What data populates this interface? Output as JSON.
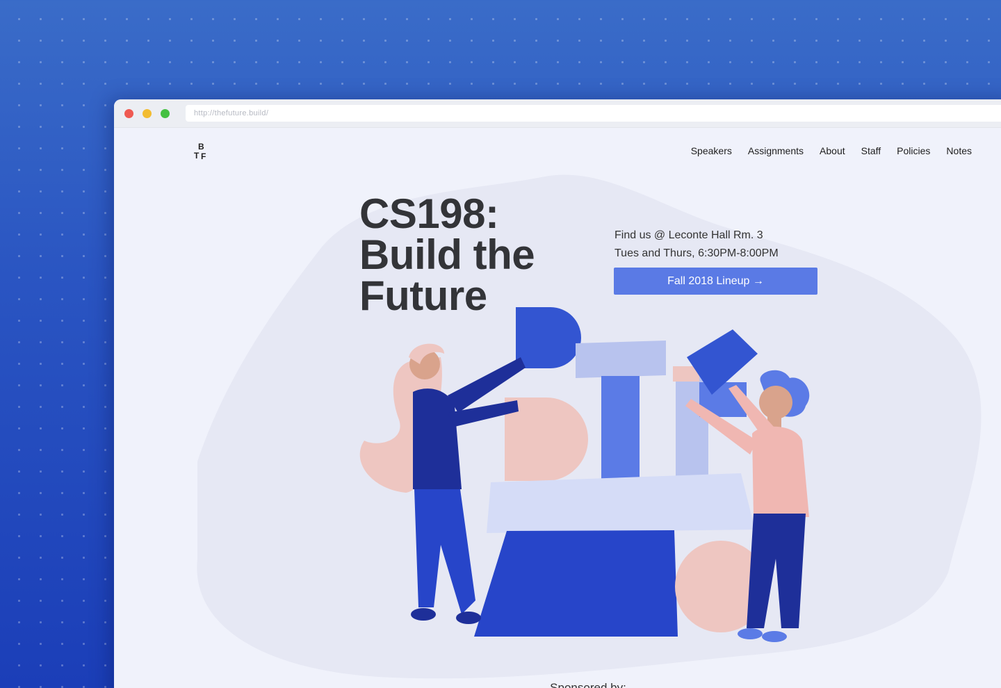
{
  "browser": {
    "url": "http://thefuture.build/"
  },
  "header": {
    "logo_letters": [
      "B",
      "T",
      "F"
    ],
    "nav": [
      {
        "label": "Speakers"
      },
      {
        "label": "Assignments"
      },
      {
        "label": "About"
      },
      {
        "label": "Staff"
      },
      {
        "label": "Policies"
      },
      {
        "label": "Notes"
      }
    ]
  },
  "hero": {
    "title": "CS198: Build the Future",
    "location": "Find us @ Leconte Hall Rm. 3",
    "schedule": "Tues and Thurs, 6:30PM-8:00PM",
    "cta_label": "Fall 2018 Lineup →"
  },
  "sponsors": {
    "label": "Sponsored by:"
  },
  "colors": {
    "brand_blue": "#5a7ae5",
    "deep_blue": "#2745c9",
    "peach": "#eec6c1",
    "page_bg": "#f0f2fb"
  }
}
